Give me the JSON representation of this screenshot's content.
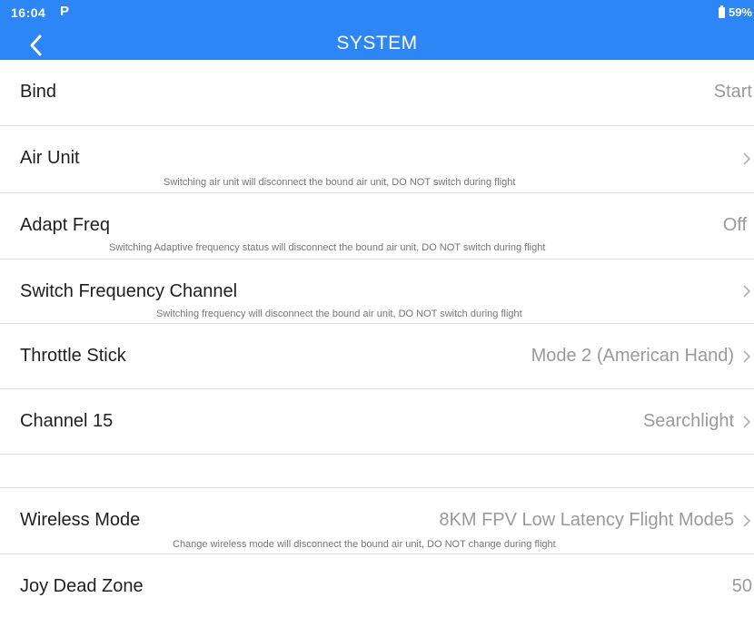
{
  "status_bar": {
    "time": "16:04",
    "notification_icon": "P",
    "battery": "59%"
  },
  "header": {
    "title": "SYSTEM",
    "back_icon": "chevron-left-icon"
  },
  "rows": [
    {
      "label": "Bind",
      "value": "Start",
      "chevron": false,
      "hint": ""
    },
    {
      "label": "Air Unit",
      "value": "",
      "chevron": true,
      "hint": "Switching air unit will disconnect the bound air unit, DO NOT switch during flight"
    },
    {
      "label": "Adapt Freq",
      "value": "Off",
      "chevron": false,
      "hint": "Switching Adaptive frequency status will disconnect the bound air unit, DO NOT switch during flight"
    },
    {
      "label": "Switch Frequency Channel",
      "value": "",
      "chevron": true,
      "hint": "Switching frequency will disconnect the bound air unit, DO NOT switch during flight"
    },
    {
      "label": "Throttle Stick",
      "value": "Mode 2 (American Hand)",
      "chevron": true,
      "hint": ""
    },
    {
      "label": "Channel 15",
      "value": "Searchlight",
      "chevron": true,
      "hint": ""
    },
    {
      "label": "Wireless Mode",
      "value": "8KM FPV Low Latency Flight Mode5",
      "chevron": true,
      "hint": "Change wireless mode will disconnect the bound air unit, DO NOT change during flight"
    },
    {
      "label": "Joy Dead Zone",
      "value": "50",
      "chevron": false,
      "hint": ""
    }
  ],
  "colors": {
    "header_bg": "#2c86f5",
    "label": "#1f1f1f",
    "value": "#9a9a9a",
    "divider": "#dcdcdc"
  }
}
